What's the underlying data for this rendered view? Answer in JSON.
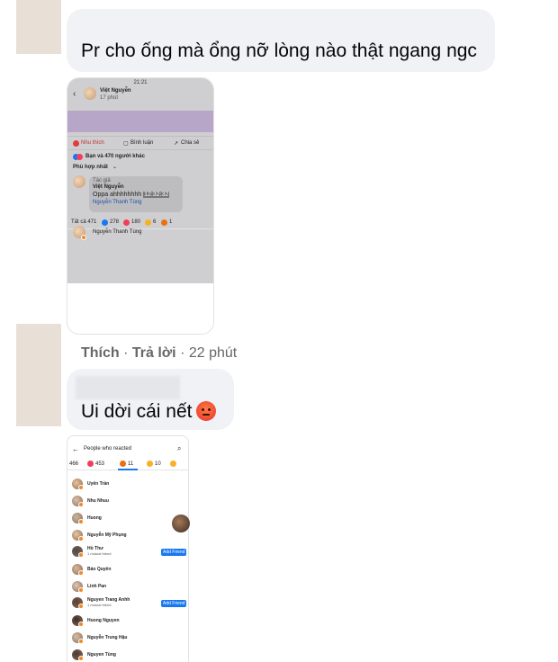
{
  "comment1": {
    "text": "Pr cho ống mà ổng nỡ lòng nào thật ngang ngc"
  },
  "screenshot1": {
    "status_time": "21:21",
    "poster_name": "Việt Nguyễn",
    "poster_time": "17 phút",
    "actions": [
      "Nhu thích",
      "Bình luận",
      "Chia sẻ"
    ],
    "reactions_summary": "Bạn và 470 người khác",
    "sort_label": "Phù hợp nhất",
    "comment_meta": "Tác giả",
    "comment_author": "Việt Nguyễn",
    "comment_text": "Oppa ahhhhhhhh",
    "comment_tag": "12:32:32",
    "comment_mention": "Nguyễn Thanh Tùng",
    "tabs": [
      {
        "label": "Tất cả 471",
        "color": "#ffffff"
      },
      {
        "label": "278",
        "color": "#1877f2"
      },
      {
        "label": "180",
        "color": "#f33e58"
      },
      {
        "label": "6",
        "color": "#f7b125"
      },
      {
        "label": "1",
        "color": "#e9710f"
      }
    ],
    "reactor_name": "Nguyễn Thanh Tùng"
  },
  "comment1_footer": {
    "like": "Thích",
    "reply": "Trả lời",
    "time": "22 phút"
  },
  "comment2": {
    "text": "Ui dời cái nết"
  },
  "screenshot2": {
    "header": "People who reacted",
    "tabs": [
      {
        "label": "466",
        "color": "#ffffff"
      },
      {
        "label": "453",
        "color": "#f33e58"
      },
      {
        "label": "11",
        "color": "#e9710f"
      },
      {
        "label": "10",
        "color": "#f7b125"
      },
      {
        "label": "",
        "color": "#f7b125"
      }
    ],
    "people": [
      {
        "name": "Uyên Trần",
        "sub": ""
      },
      {
        "name": "Nhu Nhuu",
        "sub": ""
      },
      {
        "name": "Huong",
        "sub": ""
      },
      {
        "name": "Nguyễn Mỹ Phụng",
        "sub": ""
      },
      {
        "name": "Hồ Thư",
        "sub": "1 mutual friend",
        "add": "Add Friend"
      },
      {
        "name": "Bảo Quyên",
        "sub": ""
      },
      {
        "name": "Linh Pan",
        "sub": ""
      },
      {
        "name": "Nguyen Trang Anhh",
        "sub": "1 mutual friend",
        "add": "Add Friend"
      },
      {
        "name": "Huong Nguyen",
        "sub": ""
      },
      {
        "name": "Nguyễn Trung Hậu",
        "sub": ""
      },
      {
        "name": "Nguyen Tùng",
        "sub": ""
      }
    ]
  }
}
